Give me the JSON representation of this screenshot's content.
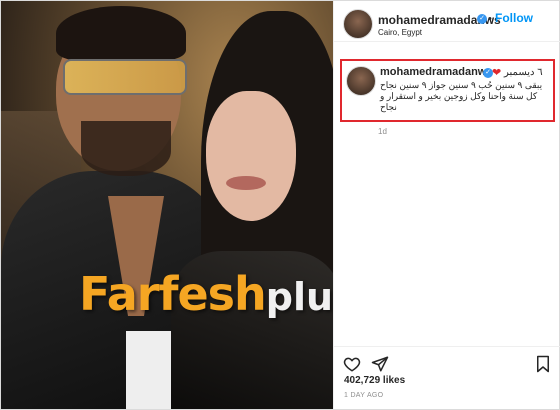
{
  "post": {
    "username": "mohamedramadanws",
    "follow_label": "Follow",
    "separator": "•",
    "location": "Cairo, Egypt",
    "verified_icon": "verified-badge-icon"
  },
  "watermark": {
    "brand": "Farfesh",
    "suffix": "plus.com"
  },
  "caption": {
    "username": "mohamedramadanws",
    "date": "٦ ديسمبر",
    "text": "يبقى ٩ سنين حُب ٩ سنين جواز ٩ سنين نجاح كل سنة واحنا وكل زوجين بخير و استقرار و نجاح",
    "time": "1d",
    "heart_color": "#e0282e",
    "highlight_color": "#e0282e"
  },
  "actions": {
    "icons": [
      "heart-outline-icon",
      "send-icon",
      "bookmark-icon"
    ]
  },
  "stats": {
    "likes": "402,729 likes",
    "posted": "1 DAY AGO"
  },
  "colors": {
    "accent": "#0095f6",
    "verified": "#3897f0",
    "text": "#262626",
    "muted": "#8e8e8e"
  }
}
